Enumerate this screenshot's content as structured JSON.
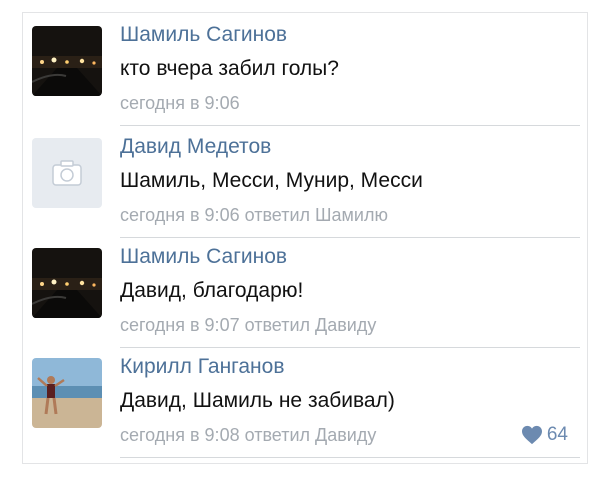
{
  "comments": [
    {
      "author": "Шамиль Сагинов",
      "text": "кто вчера забил голы?",
      "meta": "сегодня в 9:06",
      "avatar": "night-road-photo"
    },
    {
      "author": "Давид Медетов",
      "text": "Шамиль, Месси, Мунир, Месси",
      "meta": "сегодня в 9:06 ответил Шамилю",
      "avatar": "camera-icon"
    },
    {
      "author": "Шамиль Сагинов",
      "text": "Давид, благодарю!",
      "meta": "сегодня в 9:07 ответил Давиду",
      "avatar": "night-road-photo"
    },
    {
      "author": "Кирилл Ганганов",
      "text": "Давид, Шамиль не забивал)",
      "meta": "сегодня в 9:08 ответил Давиду",
      "avatar": "beach-person-photo",
      "likes": "64"
    }
  ],
  "colors": {
    "author": "#4d7198",
    "meta": "#a4aab1",
    "like": "#6c8ab0"
  }
}
